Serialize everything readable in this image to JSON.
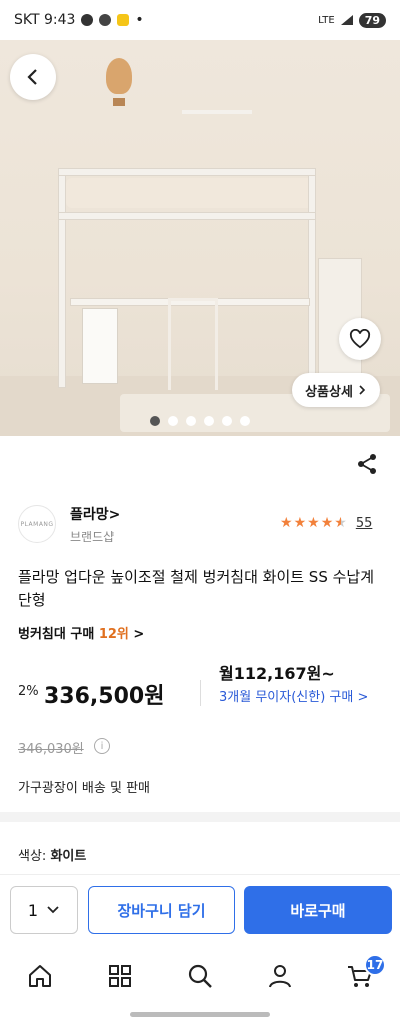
{
  "status": {
    "carrier_time": "SKT 9:43",
    "dot": "•",
    "network": "LTE",
    "battery": "79"
  },
  "hero": {
    "back_icon": "chevron-left-icon",
    "wishlist_icon": "heart-icon",
    "detail_label": "상품상세",
    "detail_icon": "chevron-right-icon",
    "slide_count": 6,
    "active_slide": 1
  },
  "share_icon": "share-icon",
  "brand": {
    "logo_text": "PLAMANG",
    "name": "플라망",
    "name_suffix": ">",
    "subtitle": "브랜드샵"
  },
  "rating": {
    "stars": 4.5,
    "review_count": "55"
  },
  "product": {
    "title": "플라망 업다운 높이조절 철제 벙커침대 화이트 SS 수납계단형"
  },
  "rank": {
    "label": "벙커침대 구매",
    "position": "12위",
    "chevron": ">"
  },
  "pricing": {
    "discount_rate": "2%",
    "price": "336,500원",
    "monthly": "월112,167원~",
    "installment": "3개월 무이자(신한) 구매 >",
    "original_price": "346,030원",
    "info_icon": "i"
  },
  "seller_info": "가구광장이 배송 및 판매",
  "option": {
    "label": "색상:",
    "value": "화이트"
  },
  "buybar": {
    "quantity": "1",
    "cart_label": "장바구니 담기",
    "buy_label": "바로구매"
  },
  "nav": {
    "items": [
      "home-icon",
      "category-icon",
      "search-icon",
      "my-page-icon",
      "cart-icon"
    ],
    "cart_badge": "17"
  },
  "colors": {
    "accent": "#2f6fe8",
    "star": "#f2813b",
    "rank": "#e0701f"
  }
}
